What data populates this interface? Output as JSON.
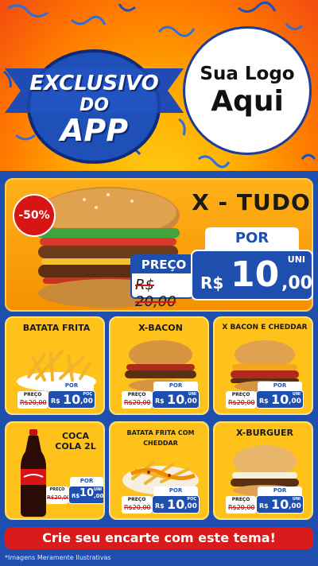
{
  "header": {
    "badge": {
      "line1": "EXCLUSIVO",
      "line2": "DO",
      "line3": "APP"
    },
    "logo": {
      "line1": "Sua Logo",
      "line2": "Aqui"
    }
  },
  "main_offer": {
    "discount": "-50%",
    "title": "X - TUDO",
    "por_label": "POR",
    "preco_label": "PREÇO",
    "old_price": "R$ 20,00",
    "currency": "R$",
    "price_int": "10",
    "price_dec": ",00",
    "unit": "UNI"
  },
  "products": [
    {
      "name": "BATATA FRITA",
      "preco_label": "PREÇO",
      "old_price": "R$20,00",
      "por_label": "POR",
      "currency": "R$",
      "price_int": "10",
      "price_dec": ",00",
      "unit": "POÇ"
    },
    {
      "name": "X-BACON",
      "preco_label": "PREÇO",
      "old_price": "R$20,00",
      "por_label": "POR",
      "currency": "R$",
      "price_int": "10",
      "price_dec": ",00",
      "unit": "UNI"
    },
    {
      "name": "X BACON E CHEDDAR",
      "preco_label": "PREÇO",
      "old_price": "R$20,00",
      "por_label": "POR",
      "currency": "R$",
      "price_int": "10",
      "price_dec": ",00",
      "unit": "UNI"
    },
    {
      "name": "COCA COLA 2L",
      "preco_label": "PREÇO",
      "old_price": "R$20,00",
      "por_label": "POR",
      "currency": "R$",
      "price_int": "10",
      "price_dec": ",00",
      "unit": "UNI"
    },
    {
      "name": "BATATA FRITA COM CHEDDAR",
      "preco_label": "PREÇO",
      "old_price": "R$20,00",
      "por_label": "POR",
      "currency": "R$",
      "price_int": "10",
      "price_dec": ",00",
      "unit": "POÇ"
    },
    {
      "name": "X-BURGUER",
      "preco_label": "PREÇO",
      "old_price": "R$20,00",
      "por_label": "POR",
      "currency": "R$",
      "price_int": "10",
      "price_dec": ",00",
      "unit": "UNI"
    }
  ],
  "footer": {
    "cta": "Crie seu encarte com este tema!",
    "note": "*Imagens Meramente Ilustrativas"
  },
  "colors": {
    "brand_blue": "#1f4fae",
    "card_yellow": "#ffc21a",
    "accent_red": "#d91b1b",
    "header_orange": "#ff7a00"
  }
}
